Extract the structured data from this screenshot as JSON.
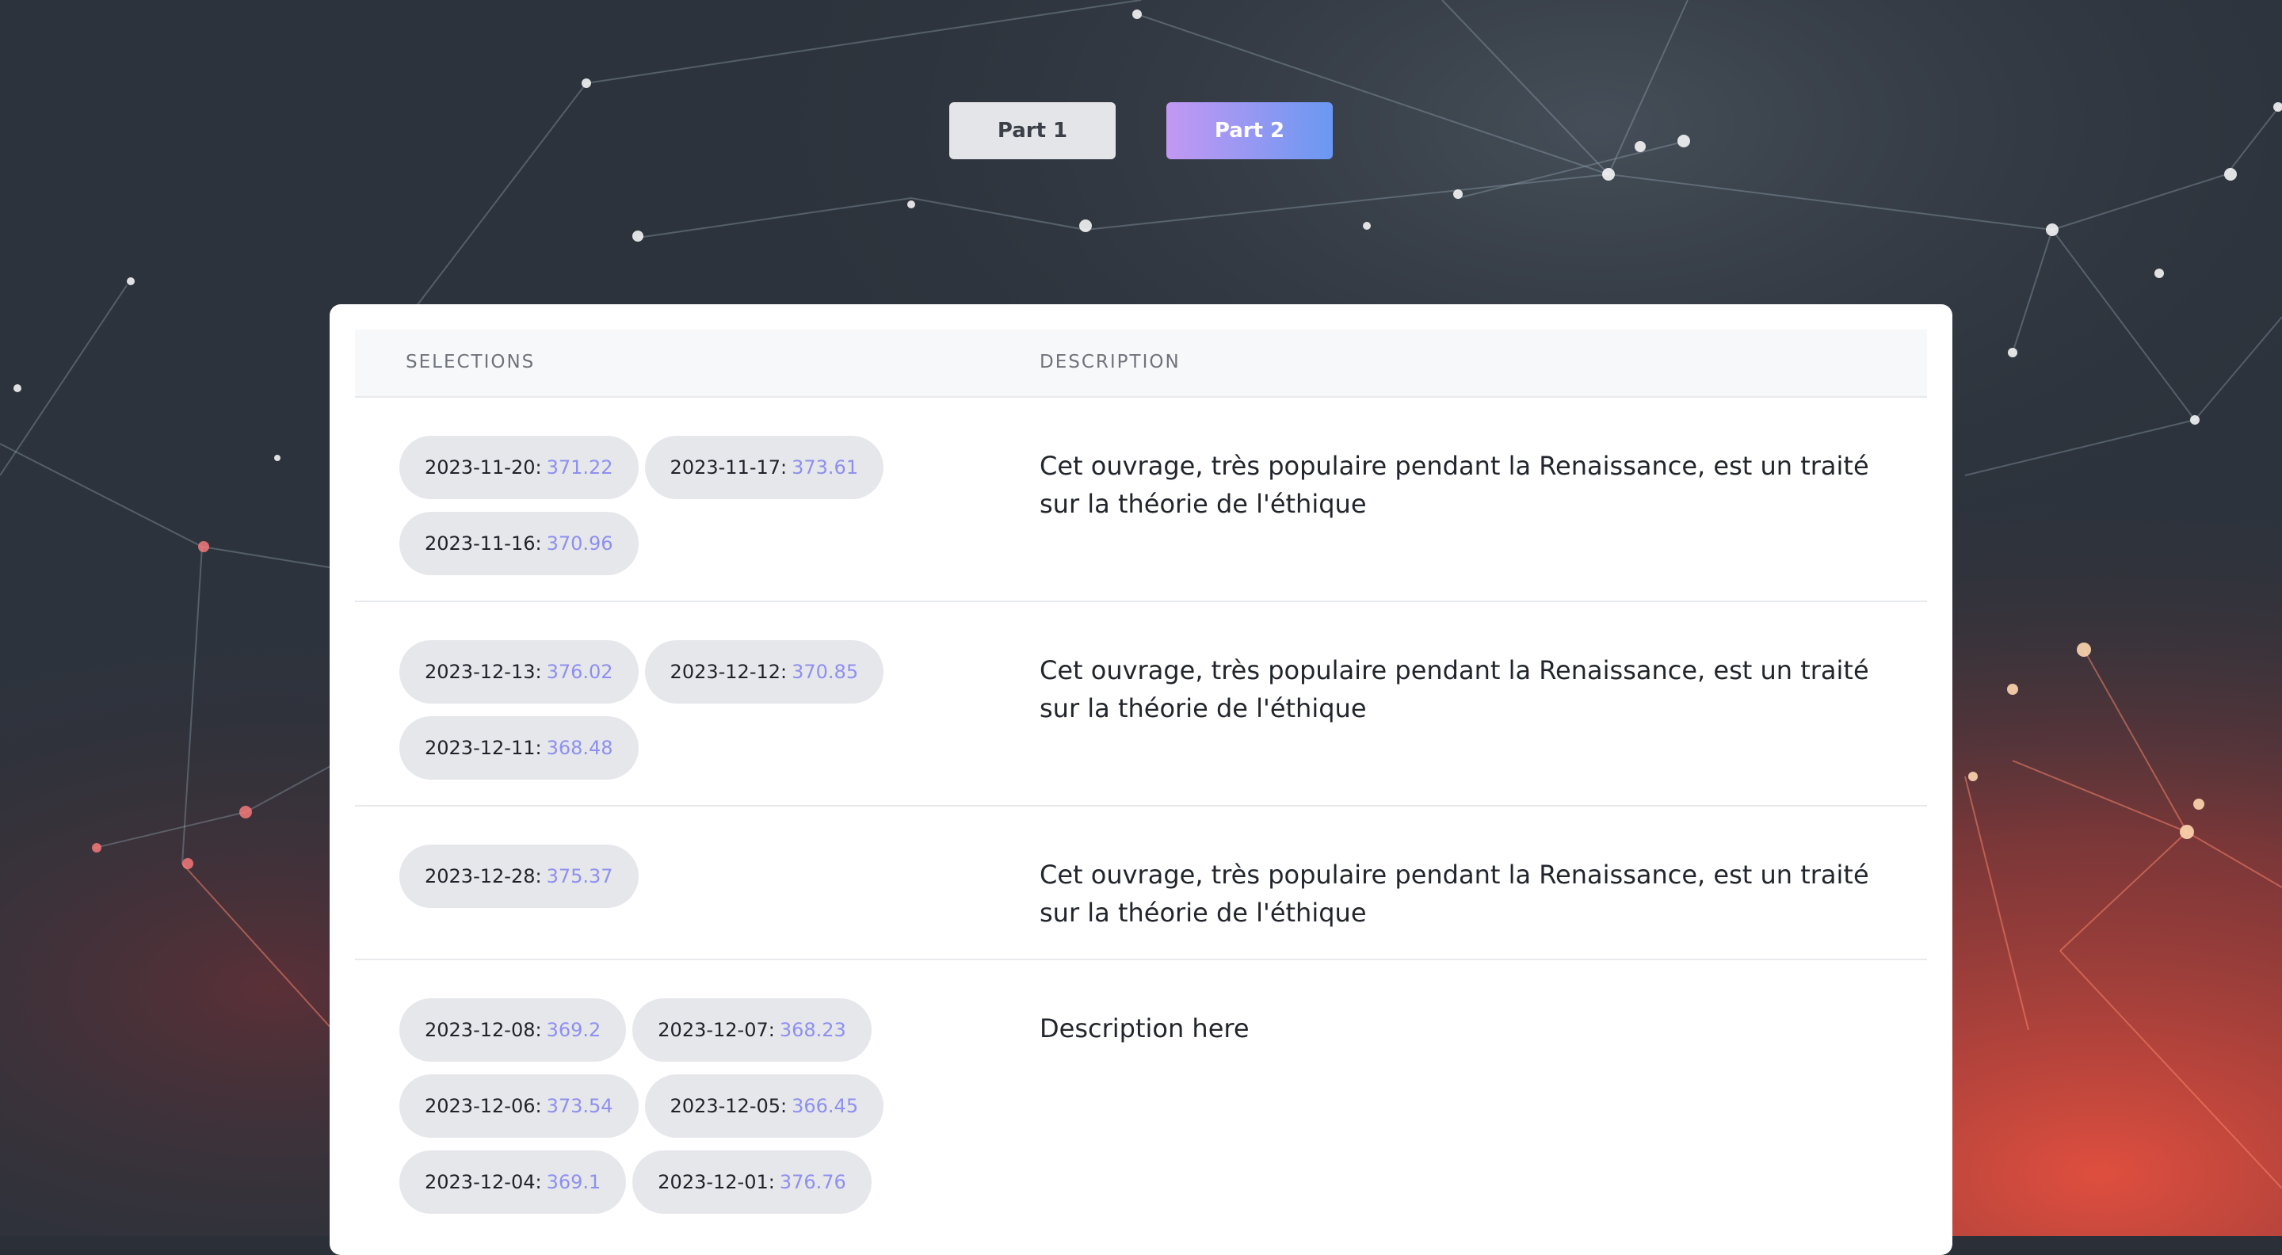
{
  "tabs": [
    {
      "label": "Part 1",
      "active": false
    },
    {
      "label": "Part 2",
      "active": true
    }
  ],
  "table": {
    "headers": {
      "selections": "SELECTIONS",
      "description": "DESCRIPTION"
    },
    "rows": [
      {
        "selections": [
          {
            "date": "2023-11-20:",
            "value": "371.22"
          },
          {
            "date": "2023-11-17:",
            "value": "373.61"
          },
          {
            "date": "2023-11-16:",
            "value": "370.96"
          }
        ],
        "description": "Cet ouvrage, très populaire pendant la Renaissance, est un traité sur la théorie de l'éthique"
      },
      {
        "selections": [
          {
            "date": "2023-12-13:",
            "value": "376.02"
          },
          {
            "date": "2023-12-12:",
            "value": "370.85"
          },
          {
            "date": "2023-12-11:",
            "value": "368.48"
          }
        ],
        "description": "Cet ouvrage, très populaire pendant la Renaissance, est un traité sur la théorie de l'éthique"
      },
      {
        "selections": [
          {
            "date": "2023-12-28:",
            "value": "375.37"
          }
        ],
        "description": "Cet ouvrage, très populaire pendant la Renaissance, est un traité sur la théorie de l'éthique"
      },
      {
        "selections": [
          {
            "date": "2023-12-08:",
            "value": "369.2"
          },
          {
            "date": "2023-12-07:",
            "value": "368.23"
          },
          {
            "date": "2023-12-06:",
            "value": "373.54"
          },
          {
            "date": "2023-12-05:",
            "value": "366.45"
          },
          {
            "date": "2023-12-04:",
            "value": "369.1"
          },
          {
            "date": "2023-12-01:",
            "value": "376.76"
          }
        ],
        "description": "Description here"
      }
    ]
  },
  "colors": {
    "tab_gradient_start": "#c398f3",
    "tab_gradient_end": "#6a98f2",
    "chip_background": "#e6e7eb",
    "chip_value": "#8f8ff0",
    "background_dark": "#2b3038",
    "background_red": "#e0473a"
  }
}
